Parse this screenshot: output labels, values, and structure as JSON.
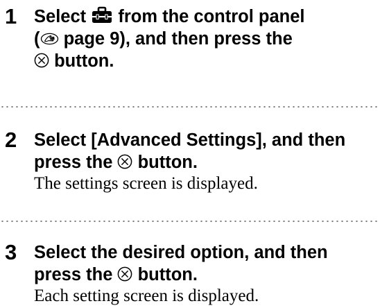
{
  "steps": [
    {
      "number": "1",
      "line1_pre": "Select",
      "line1_post": "from the control panel",
      "line2_pre": "(",
      "line2_post": "page 9), and then press the",
      "line3_post": "button."
    },
    {
      "number": "2",
      "line1": "Select [Advanced Settings], and then",
      "line2_pre": "press the",
      "line2_post": "button.",
      "result": "The settings screen is displayed."
    },
    {
      "number": "3",
      "line1": "Select the desired option, and then",
      "line2_pre": "press the",
      "line2_post": "button.",
      "result": "Each setting screen is displayed."
    }
  ],
  "icons": {
    "settings": "toolbox-icon",
    "page_reference": "page-reference-icon",
    "confirm_button": "circle-x-button-icon"
  }
}
